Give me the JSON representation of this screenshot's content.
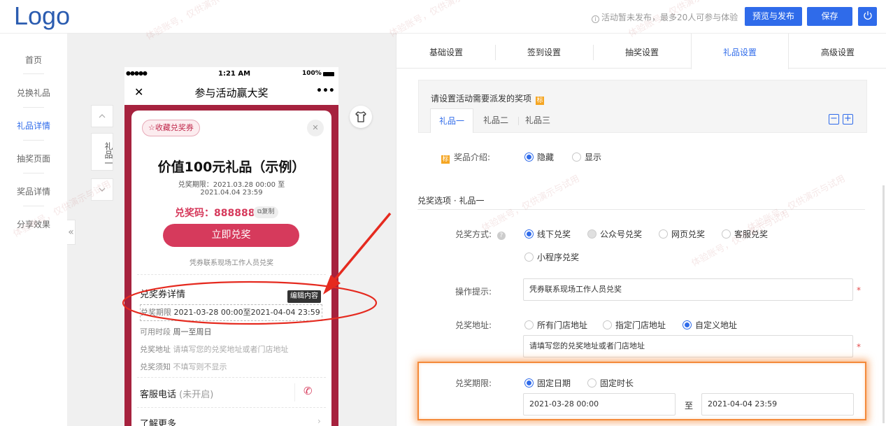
{
  "header": {
    "logo": "Logo",
    "notice": "活动暂未发布，最多20人可参与体验",
    "preview_publish": "预览与发布",
    "save": "保存"
  },
  "sidebar": {
    "items": [
      {
        "label": "首页"
      },
      {
        "label": "兑换礼品"
      },
      {
        "label": "礼品详情"
      },
      {
        "label": "抽奖页面"
      },
      {
        "label": "奖品详情"
      },
      {
        "label": "分享效果"
      }
    ],
    "collapse": "«",
    "active_color": "#2f6bea"
  },
  "preview": {
    "status_dots": "●●●●●",
    "time": "1:21 AM",
    "battery": "100%",
    "close": "✕",
    "title": "参与活动赢大奖",
    "more": "•••",
    "collect_coupon": "收藏兑奖券",
    "prize_title": "价值100元礼品（示例）",
    "period_line1": "兑奖期限：2021.03.28 00:00 至",
    "period_line2": "2021.04.04 23:59",
    "code_label": "兑奖码：888888",
    "copy": "复制",
    "redeem_now": "立即兑奖",
    "redeem_hint": "凭券联系现场工作人员兑奖",
    "coupon_details": "兑奖券详情",
    "edit_tooltip": "编辑内容",
    "rows": [
      {
        "label": "兑奖期限",
        "value": "2021-03-28 00:00至2021-04-04 23:59"
      },
      {
        "label": "可用时段",
        "value": "周一至周日"
      },
      {
        "label": "兑奖地址",
        "value": "请填写您的兑奖地址或者门店地址"
      },
      {
        "label": "兑奖须知",
        "value": "不填写则不显示"
      }
    ],
    "service_phone": "客服电话",
    "service_status": "(未开启)",
    "learn_more": "了解更多",
    "side_label": "礼品一",
    "brand_color": "#a6223e",
    "button_color": "#d63a5c"
  },
  "tabs": [
    {
      "label": "基础设置"
    },
    {
      "label": "签到设置"
    },
    {
      "label": "抽奖设置"
    },
    {
      "label": "礼品设置"
    },
    {
      "label": "高级设置"
    }
  ],
  "gift_panel": {
    "heading": "请设置活动需要派发的奖项",
    "gift_tabs": [
      "礼品一",
      "礼品二",
      "礼品三"
    ],
    "intro_label": "奖品介绍:",
    "intro_options": [
      "隐藏",
      "显示"
    ],
    "section_title": "兑奖选项 · 礼品一",
    "method_label": "兑奖方式:",
    "method_options": [
      "线下兑奖",
      "公众号兑奖",
      "网页兑奖",
      "客服兑奖",
      "小程序兑奖"
    ],
    "tip_label": "操作提示:",
    "tip_value": "凭券联系现场工作人员兑奖",
    "address_label": "兑奖地址:",
    "address_options": [
      "所有门店地址",
      "指定门店地址",
      "自定义地址"
    ],
    "address_value": "请填写您的兑奖地址或者门店地址",
    "period_label": "兑奖期限:",
    "period_options": [
      "固定日期",
      "固定时长"
    ],
    "start_date": "2021-03-28 00:00",
    "to": "至",
    "end_date": "2021-04-04 23:59"
  },
  "watermark": "体验账号，仅供演示与试用"
}
